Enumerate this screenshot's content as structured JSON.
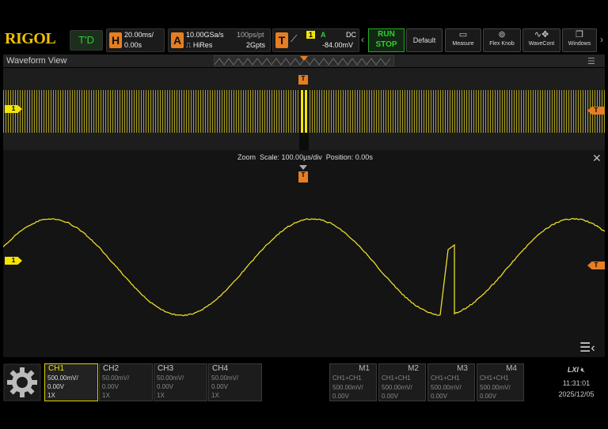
{
  "brand": "RIGOL",
  "trigger_display": "T'D",
  "horizontal": {
    "badge": "H",
    "timebase": "20.00ms/",
    "offset": "0.00s"
  },
  "acquire": {
    "badge": "A",
    "sample_rate": "10.00GSa/s",
    "mode": "HiRes",
    "points_per": "100ps/pt",
    "depth": "2Gpts"
  },
  "trigger": {
    "badge": "T",
    "source": "1",
    "mode": "A",
    "coupling": "DC",
    "level": "-84.00mV"
  },
  "run_stop": {
    "run": "RUN",
    "stop": "STOP"
  },
  "toolbar": [
    {
      "label": "Default",
      "icon": "default-icon"
    },
    {
      "label": "Measure",
      "icon": "ruler-icon"
    },
    {
      "label": "Flex Knob",
      "icon": "knob-icon"
    },
    {
      "label": "WaveCont",
      "icon": "wave-icon"
    },
    {
      "label": "Windows",
      "icon": "windows-icon"
    }
  ],
  "waveform_view": {
    "title": "Waveform View"
  },
  "zoom": {
    "label": "Zoom",
    "scale": "Scale: 100.00µs/div",
    "position": "Position: 0.00s"
  },
  "markers": {
    "channel": "1",
    "trigger": "T"
  },
  "channels": [
    {
      "name": "CH1",
      "scale": "500.00mV/",
      "offset": "0.00V",
      "probe": "1X",
      "active": true
    },
    {
      "name": "CH2",
      "scale": "50.00mV/",
      "offset": "0.00V",
      "probe": "1X",
      "active": false
    },
    {
      "name": "CH3",
      "scale": "50.00mV/",
      "offset": "0.00V",
      "probe": "1X",
      "active": false
    },
    {
      "name": "CH4",
      "scale": "50.00mV/",
      "offset": "0.00V",
      "probe": "1X",
      "active": false
    }
  ],
  "math": [
    {
      "name": "M1",
      "expr": "CH1+CH1",
      "scale": "500.00mV/",
      "offset": "0.00V"
    },
    {
      "name": "M2",
      "expr": "CH1+CH1",
      "scale": "500.00mV/",
      "offset": "0.00V"
    },
    {
      "name": "M3",
      "expr": "CH1+CH1",
      "scale": "500.00mV/",
      "offset": "0.00V"
    },
    {
      "name": "M4",
      "expr": "CH1+CH1",
      "scale": "500.00mV/",
      "offset": "0.00V"
    }
  ],
  "status": {
    "lxi": "LXI",
    "time": "11:31:01",
    "date": "2025/12/05"
  },
  "colors": {
    "ch1": "#f2e600",
    "trigger": "#e67e22",
    "run": "#33cc33"
  }
}
